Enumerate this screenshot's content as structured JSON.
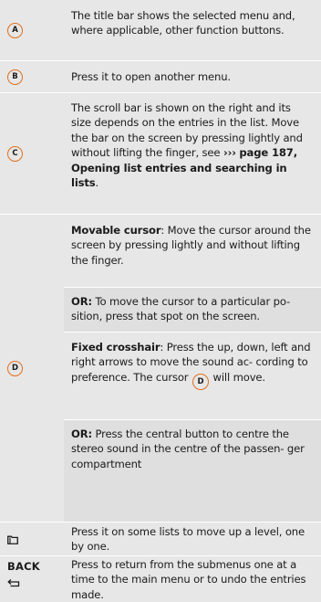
{
  "rows": {
    "a": {
      "badge": "A",
      "text": "The title bar shows the selected menu and, where applicable, other function buttons."
    },
    "b": {
      "badge": "B",
      "text": "Press it to open another menu."
    },
    "c": {
      "badge": "C",
      "text": "The scroll bar is shown on the right and its size depends on the entries in the list. Move the bar on the screen by pressing lightly and without lifting the finger, see",
      "link_arrows": "›››",
      "link_text": "page 187, Opening list entries and searching in lists",
      "link_end": "."
    },
    "d": {
      "badge": "D",
      "movable_label": "Movable cursor",
      "movable_text": ": Move the cursor around the screen by pressing lightly and without lifting the finger.",
      "or1_label": "OR:",
      "or1_text": " To move the cursor to a particular po- sition, press that spot on the screen.",
      "fixed_label": "Fixed crosshair",
      "fixed_text": ": Press the up, down, left and right arrows to move the sound ac- cording to preference. The cursor",
      "fixed_badge": "D",
      "fixed_end": " will move.",
      "or2_label": "OR:",
      "or2_text": " Press the central button to centre the stereo sound in the centre of the passen- ger compartment"
    },
    "folder": {
      "icon": "folder-up-icon",
      "text": "Press it on some lists to move up a level, one by one."
    },
    "back": {
      "label": "BACK",
      "icon": "return-arrow-icon",
      "text": "Press to return from the submenus one at a time to the main menu or to undo the entries made."
    }
  },
  "colors": {
    "badge_ring": "#e0701f",
    "background": "#e7e7e7"
  }
}
